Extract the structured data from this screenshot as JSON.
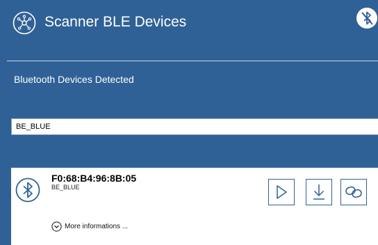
{
  "header": {
    "title": "Scanner BLE Devices",
    "logo_icon": "network-hub-icon",
    "settings_icon": "bluetooth-disabled-icon"
  },
  "section": {
    "title": "Bluetooth Devices Detected"
  },
  "filter": {
    "value": "BE_BLUE"
  },
  "device": {
    "mac": "F0:68:B4:96:8B:05",
    "name": "BE_BLUE",
    "icon": "bluetooth-icon",
    "more_info_label": "More informations ...",
    "actions": [
      {
        "name": "play",
        "icon": "play-icon"
      },
      {
        "name": "download",
        "icon": "download-icon"
      },
      {
        "name": "connect",
        "icon": "link-icon"
      }
    ]
  },
  "colors": {
    "background": "#2f6196",
    "card": "#ffffff",
    "text_on_dark": "#ffffff",
    "accent": "#2f6196"
  }
}
